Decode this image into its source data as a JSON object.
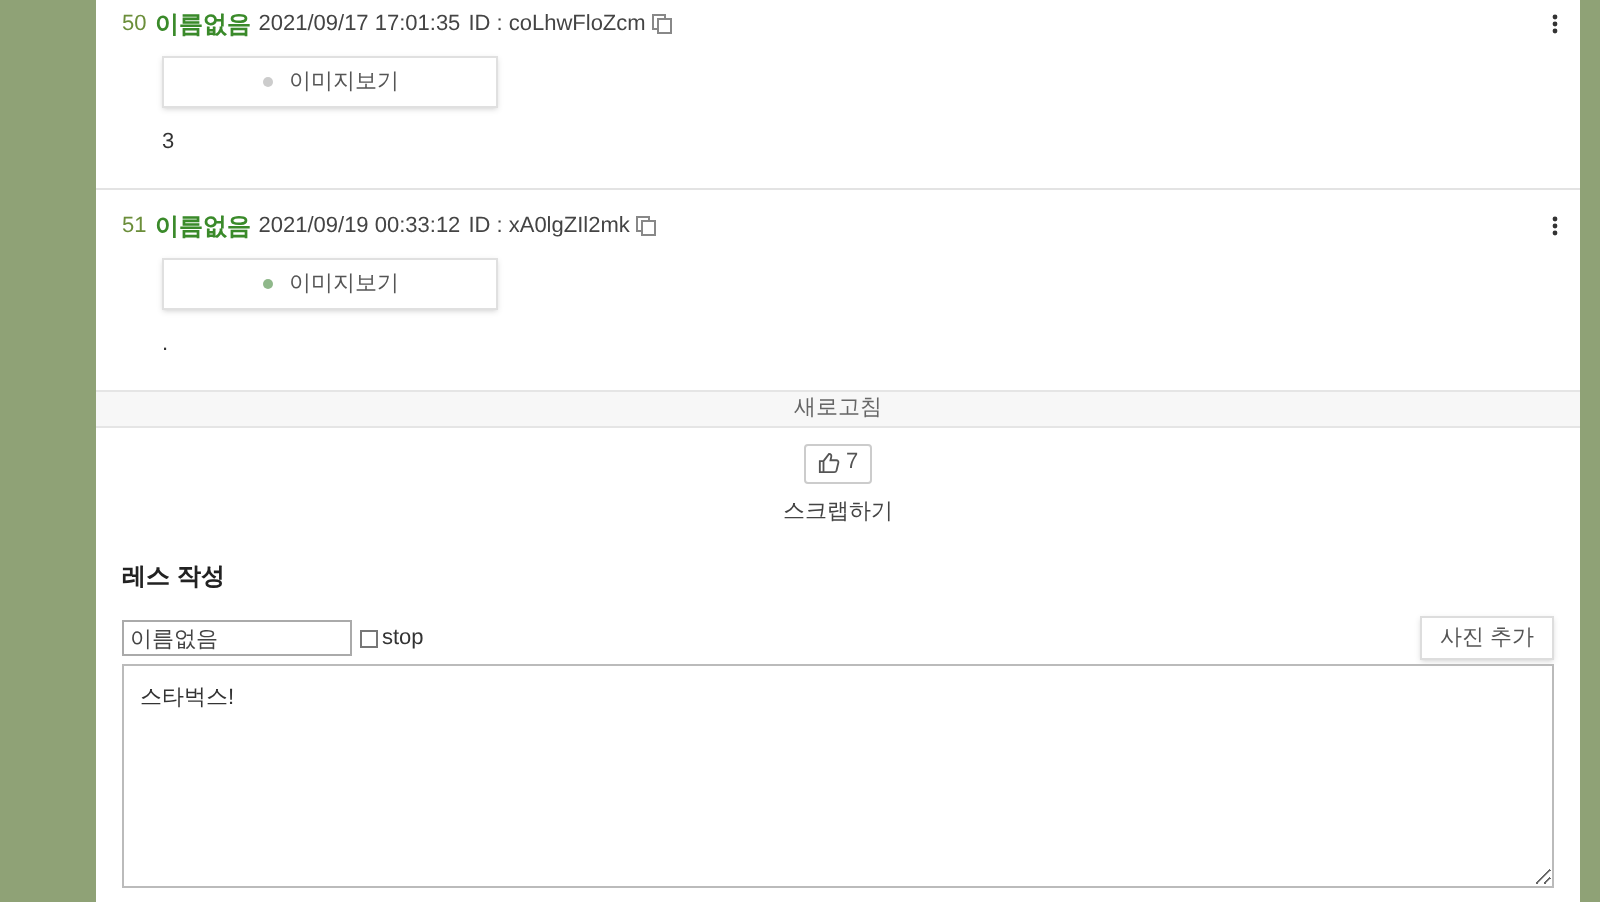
{
  "posts": [
    {
      "number": "50",
      "author": "이름없음",
      "datetime": "2021/09/17 17:01:35",
      "id": "ID : coLhwFloZcm",
      "image_button": "이미지보기",
      "body": "3"
    },
    {
      "number": "51",
      "author": "이름없음",
      "datetime": "2021/09/19 00:33:12",
      "id": "ID : xA0lgZIl2mk",
      "image_button": "이미지보기",
      "body": "."
    }
  ],
  "refresh": "새로고침",
  "like": {
    "count": "7"
  },
  "scrap": "스크랩하기",
  "reply_form": {
    "title": "레스 작성",
    "name_field": {
      "value": "이름없음"
    },
    "stop": {
      "label": "stop",
      "checked": false
    },
    "add_photo": "사진 추가",
    "message": {
      "value": "스타벅스!"
    }
  }
}
